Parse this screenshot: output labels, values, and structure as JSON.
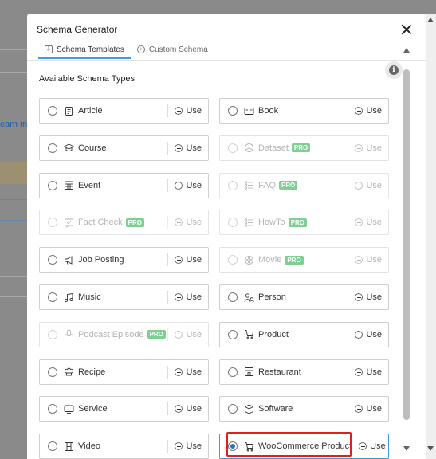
{
  "modal": {
    "title": "Schema Generator",
    "tabs": [
      {
        "label": "Schema Templates",
        "active": true,
        "icon": "template-icon"
      },
      {
        "label": "Custom Schema",
        "active": false,
        "icon": "plus-circle-icon"
      }
    ],
    "section_title": "Available Schema Types",
    "use_label": "Use",
    "pro_label": "PRO",
    "accent_color": "#3aa0d8",
    "highlight_color": "#e02020"
  },
  "background": {
    "link_text": "earn mo"
  },
  "schema_types": [
    {
      "label": "Article",
      "icon": "article-icon",
      "pro": false,
      "disabled": false,
      "selected": false
    },
    {
      "label": "Book",
      "icon": "book-icon",
      "pro": false,
      "disabled": false,
      "selected": false
    },
    {
      "label": "Course",
      "icon": "graduation-cap-icon",
      "pro": false,
      "disabled": false,
      "selected": false
    },
    {
      "label": "Dataset",
      "icon": "dataset-icon",
      "pro": true,
      "disabled": true,
      "selected": false
    },
    {
      "label": "Event",
      "icon": "calendar-icon",
      "pro": false,
      "disabled": false,
      "selected": false
    },
    {
      "label": "FAQ",
      "icon": "list-icon",
      "pro": true,
      "disabled": true,
      "selected": false
    },
    {
      "label": "Fact Check",
      "icon": "fact-check-icon",
      "pro": true,
      "disabled": true,
      "selected": false
    },
    {
      "label": "HowTo",
      "icon": "list-icon",
      "pro": true,
      "disabled": true,
      "selected": false
    },
    {
      "label": "Job Posting",
      "icon": "megaphone-icon",
      "pro": false,
      "disabled": false,
      "selected": false
    },
    {
      "label": "Movie",
      "icon": "movie-icon",
      "pro": true,
      "disabled": true,
      "selected": false
    },
    {
      "label": "Music",
      "icon": "music-icon",
      "pro": false,
      "disabled": false,
      "selected": false
    },
    {
      "label": "Person",
      "icon": "person-icon",
      "pro": false,
      "disabled": false,
      "selected": false
    },
    {
      "label": "Podcast Episode",
      "icon": "microphone-icon",
      "pro": true,
      "disabled": true,
      "selected": false
    },
    {
      "label": "Product",
      "icon": "cart-icon",
      "pro": false,
      "disabled": false,
      "selected": false
    },
    {
      "label": "Recipe",
      "icon": "chef-hat-icon",
      "pro": false,
      "disabled": false,
      "selected": false
    },
    {
      "label": "Restaurant",
      "icon": "restaurant-icon",
      "pro": false,
      "disabled": false,
      "selected": false
    },
    {
      "label": "Service",
      "icon": "monitor-icon",
      "pro": false,
      "disabled": false,
      "selected": false
    },
    {
      "label": "Software",
      "icon": "box-icon",
      "pro": false,
      "disabled": false,
      "selected": false
    },
    {
      "label": "Video",
      "icon": "film-icon",
      "pro": false,
      "disabled": false,
      "selected": false
    },
    {
      "label": "WooCommerce Product",
      "icon": "cart-icon",
      "pro": false,
      "disabled": false,
      "selected": true
    }
  ]
}
